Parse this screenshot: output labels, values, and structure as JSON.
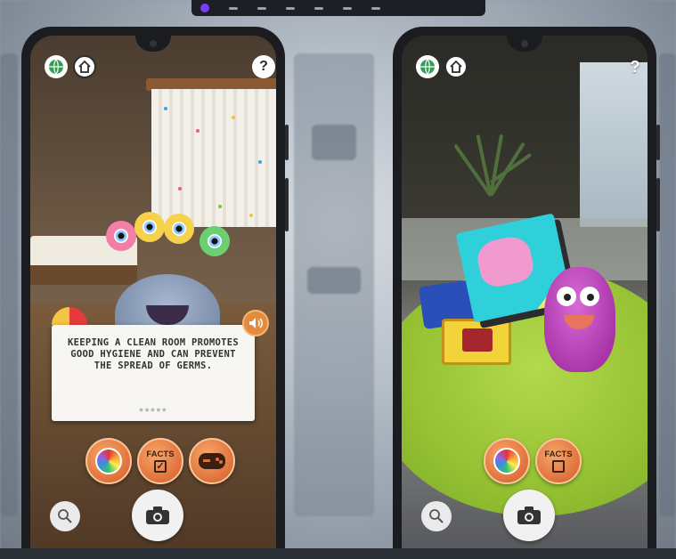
{
  "left_phone": {
    "fact_card": {
      "text": "KEEPING A CLEAN ROOM PROMOTES GOOD HYGIENE AND CAN PREVENT THE SPREAD OF GERMS.",
      "pager": "●●●●●"
    },
    "help_label": "?",
    "facts_label": "FACTS",
    "facts_check": "✓"
  },
  "right_phone": {
    "help_label": "?",
    "facts_label": "FACTS"
  },
  "icons": {
    "globe": "globe-icon",
    "home": "home-icon",
    "help": "question-mark-icon",
    "sound": "speaker-icon",
    "brush": "color-brush-icon",
    "game": "gamepad-icon",
    "search": "magnifier-icon",
    "camera": "camera-icon"
  },
  "colors": {
    "accent_orange": "#e0703a",
    "card_bg": "#f7f6f2",
    "rug_green": "#93c031"
  }
}
